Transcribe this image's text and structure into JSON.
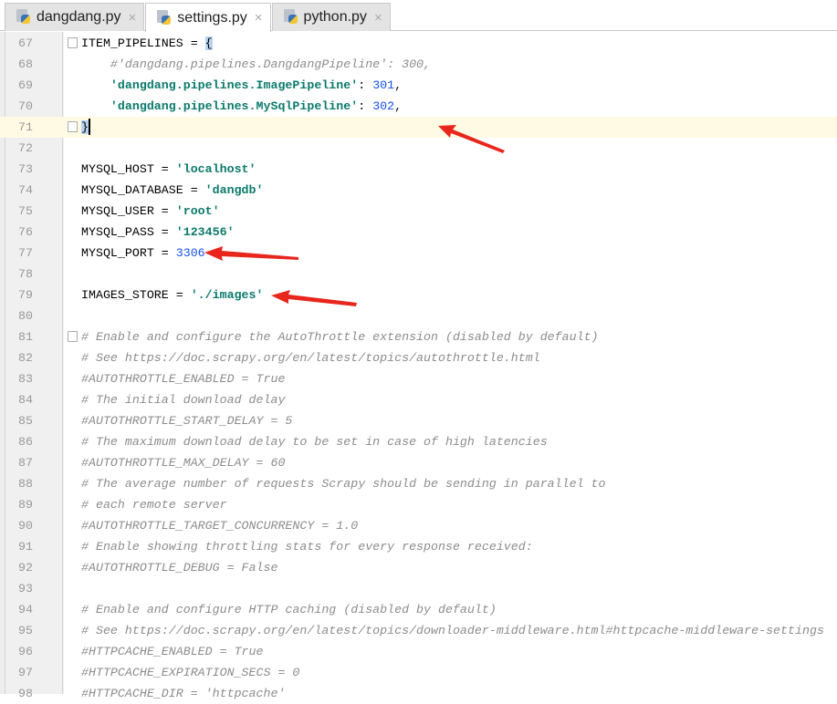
{
  "tabs": [
    {
      "label": "dangdang.py",
      "active": false
    },
    {
      "label": "settings.py",
      "active": true
    },
    {
      "label": "python.py",
      "active": false
    }
  ],
  "close_glyph": "×",
  "current_line": 71,
  "lines": [
    {
      "n": "67",
      "fold": true,
      "tokens": [
        [
          "k",
          "ITEM_PIPELINES = "
        ],
        [
          "b",
          "{"
        ]
      ]
    },
    {
      "n": "68",
      "tokens": [
        [
          "k",
          "    "
        ],
        [
          "c",
          "#'dangdang.pipelines.DangdangPipeline': 300,"
        ]
      ]
    },
    {
      "n": "69",
      "tokens": [
        [
          "k",
          "    "
        ],
        [
          "s",
          "'dangdang.pipelines.ImagePipeline'"
        ],
        [
          "k",
          ": "
        ],
        [
          "n",
          "301"
        ],
        [
          "k",
          ","
        ]
      ]
    },
    {
      "n": "70",
      "tokens": [
        [
          "k",
          "    "
        ],
        [
          "s",
          "'dangdang.pipelines.MySqlPipeline'"
        ],
        [
          "k",
          ": "
        ],
        [
          "n",
          "302"
        ],
        [
          "k",
          ","
        ]
      ]
    },
    {
      "n": "71",
      "fold": true,
      "tokens": [
        [
          "b",
          "}"
        ]
      ]
    },
    {
      "n": "72",
      "tokens": []
    },
    {
      "n": "73",
      "tokens": [
        [
          "k",
          "MYSQL_HOST = "
        ],
        [
          "s",
          "'localhost'"
        ]
      ]
    },
    {
      "n": "74",
      "tokens": [
        [
          "k",
          "MYSQL_DATABASE = "
        ],
        [
          "s",
          "'dangdb'"
        ]
      ]
    },
    {
      "n": "75",
      "tokens": [
        [
          "k",
          "MYSQL_USER = "
        ],
        [
          "s",
          "'root'"
        ]
      ]
    },
    {
      "n": "76",
      "tokens": [
        [
          "k",
          "MYSQL_PASS = "
        ],
        [
          "s",
          "'123456'"
        ]
      ]
    },
    {
      "n": "77",
      "tokens": [
        [
          "k",
          "MYSQL_PORT = "
        ],
        [
          "n",
          "3306"
        ]
      ]
    },
    {
      "n": "78",
      "tokens": []
    },
    {
      "n": "79",
      "tokens": [
        [
          "k",
          "IMAGES_STORE = "
        ],
        [
          "s",
          "'./images'"
        ]
      ]
    },
    {
      "n": "80",
      "tokens": []
    },
    {
      "n": "81",
      "fold": true,
      "tokens": [
        [
          "c",
          "# Enable and configure the AutoThrottle extension (disabled by default)"
        ]
      ]
    },
    {
      "n": "82",
      "tokens": [
        [
          "c",
          "# See https://doc.scrapy.org/en/latest/topics/autothrottle.html"
        ]
      ]
    },
    {
      "n": "83",
      "tokens": [
        [
          "c",
          "#AUTOTHROTTLE_ENABLED = True"
        ]
      ]
    },
    {
      "n": "84",
      "tokens": [
        [
          "c",
          "# The initial download delay"
        ]
      ]
    },
    {
      "n": "85",
      "tokens": [
        [
          "c",
          "#AUTOTHROTTLE_START_DELAY = 5"
        ]
      ]
    },
    {
      "n": "86",
      "tokens": [
        [
          "c",
          "# The maximum download delay to be set in case of high latencies"
        ]
      ]
    },
    {
      "n": "87",
      "tokens": [
        [
          "c",
          "#AUTOTHROTTLE_MAX_DELAY = 60"
        ]
      ]
    },
    {
      "n": "88",
      "tokens": [
        [
          "c",
          "# The average number of requests Scrapy should be sending in parallel to"
        ]
      ]
    },
    {
      "n": "89",
      "tokens": [
        [
          "c",
          "# each remote server"
        ]
      ]
    },
    {
      "n": "90",
      "tokens": [
        [
          "c",
          "#AUTOTHROTTLE_TARGET_CONCURRENCY = 1.0"
        ]
      ]
    },
    {
      "n": "91",
      "tokens": [
        [
          "c",
          "# Enable showing throttling stats for every response received:"
        ]
      ]
    },
    {
      "n": "92",
      "tokens": [
        [
          "c",
          "#AUTOTHROTTLE_DEBUG = False"
        ]
      ]
    },
    {
      "n": "93",
      "tokens": []
    },
    {
      "n": "94",
      "tokens": [
        [
          "c",
          "# Enable and configure HTTP caching (disabled by default)"
        ]
      ]
    },
    {
      "n": "95",
      "tokens": [
        [
          "c",
          "# See https://doc.scrapy.org/en/latest/topics/downloader-middleware.html#httpcache-middleware-settings"
        ]
      ]
    },
    {
      "n": "96",
      "tokens": [
        [
          "c",
          "#HTTPCACHE_ENABLED = True"
        ]
      ]
    },
    {
      "n": "97",
      "tokens": [
        [
          "c",
          "#HTTPCACHE_EXPIRATION_SECS = 0"
        ]
      ]
    },
    {
      "n": "98",
      "tokens": [
        [
          "c",
          "#HTTPCACHE_DIR = 'httpcache'"
        ]
      ]
    }
  ],
  "annotation_color": "#e8261c"
}
